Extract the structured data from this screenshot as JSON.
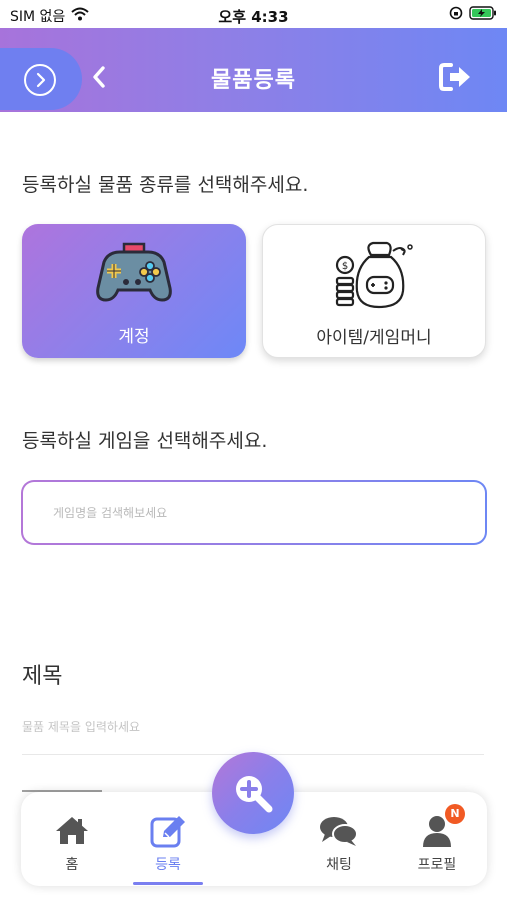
{
  "status_bar": {
    "carrier": "SIM 없음",
    "time": "오후 4:33"
  },
  "header": {
    "title": "물품등록"
  },
  "category": {
    "prompt": "등록하실 물품 종류를 선택해주세요.",
    "options": [
      {
        "label": "계정",
        "icon": "gamepad-icon",
        "selected": true
      },
      {
        "label": "아이템/게임머니",
        "icon": "money-bag-gamepad-icon",
        "selected": false
      }
    ]
  },
  "game": {
    "prompt": "등록하실 게임을 선택해주세요.",
    "search_placeholder": "게임명을 검색해보세요",
    "search_value": ""
  },
  "product_title": {
    "label": "제목",
    "placeholder": "물품 제목을 입력하세요",
    "value": ""
  },
  "tabbar": {
    "tabs": [
      {
        "label": "홈",
        "icon": "home-icon",
        "active": false
      },
      {
        "label": "등록",
        "icon": "edit-icon",
        "active": true
      },
      {
        "label": "채팅",
        "icon": "chat-icon",
        "active": false
      },
      {
        "label": "프로필",
        "icon": "user-icon",
        "active": false,
        "badge": "N"
      }
    ],
    "fab_icon": "search-plus-icon"
  },
  "colors": {
    "accent_start": "#b477d8",
    "accent_end": "#6e87f4",
    "badge": "#f15a24"
  }
}
